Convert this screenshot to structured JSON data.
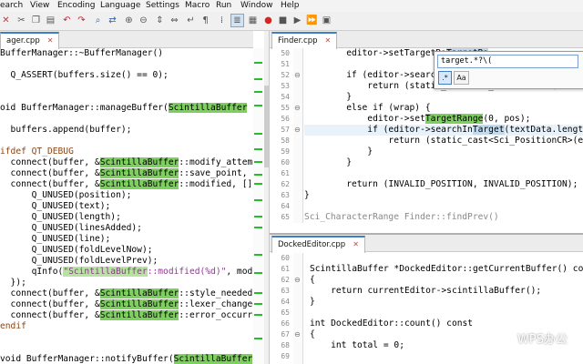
{
  "menu": [
    "earch",
    "View",
    "Encoding",
    "Language",
    "Settings",
    "Macro",
    "Run",
    "Window",
    "Help"
  ],
  "toolbar_icons": [
    "delete-icon",
    "cut-icon",
    "copy-icon",
    "paste-icon",
    "undo-icon",
    "redo-icon",
    "find-icon",
    "replace-icon",
    "zoom-in-icon",
    "zoom-out-icon",
    "sync-v-icon",
    "sync-h-icon",
    "wrap-icon",
    "all-chars-icon",
    "indent-guide-icon",
    "doc-map-icon",
    "function-list-icon",
    "record-macro-icon",
    "stop-macro-icon",
    "play-macro-icon",
    "run-macro-multiple-icon",
    "save-macro-icon"
  ],
  "left_pane": {
    "tab_label": "ager.cpp",
    "lines": [
      "BufferManager::~BufferManager()",
      "",
      "  Q_ASSERT(buffers.size() == 0);",
      "",
      "",
      "oid BufferManager::manageBuffer(",
      "",
      "  buffers.append(buffer);",
      "",
      "ifdef QT_DEBUG",
      "  connect(buffer, &",
      "  connect(buffer, &",
      "  connect(buffer, &",
      "      Q_UNUSED(position);",
      "      Q_UNUSED(text);",
      "      Q_UNUSED(length);",
      "      Q_UNUSED(linesAdded);",
      "      Q_UNUSED(line);",
      "      Q_UNUSED(foldLevelNow);",
      "      Q_UNUSED(foldLevelPrev);",
      "      qInfo(",
      "  });",
      "  connect(buffer, &",
      "  connect(buffer, &",
      "  connect(buffer, &",
      "endif",
      "",
      "",
      "void BufferManager::notifyBuffer("
    ],
    "hl_words": {
      "w5": "ScintillaBuffer",
      "w5b": " *",
      "w10": "ScintillaBuffer",
      "w10b": "::modify_attemp",
      "w11": "ScintillaBuffer",
      "w11b": "::save_point,",
      "w12": "ScintillaBuffer",
      "w12b": "::modified, []",
      "w20": "\"ScintillaBuffer",
      "w20b": "::modified(%d)\"",
      "w20c": ", modi",
      "w22": "ScintillaBuffer",
      "w22b": "::style_needed",
      "w23": "ScintillaBuffer",
      "w23b": "::lexer_changed",
      "w24": "ScintillaBuffer",
      "w24b": "::error_occurre",
      "w28": "ScintillaBuffer"
    }
  },
  "finder_pane": {
    "tab_label": "Finder.cpp",
    "line_numbers": [
      "50",
      "51",
      "52",
      "53",
      "54",
      "55",
      "56",
      "57",
      "58",
      "59",
      "60",
      "61",
      "62",
      "63",
      "64",
      "65"
    ],
    "lines": [
      "        editor->setTargetRa",
      "",
      "        if (editor->searchIn",
      "            return (static_cast<Sci_PositionCR>(editor->",
      "        }",
      "        else if (wrap) {",
      "            editor->set",
      "            if (editor->searchIn",
      "                return (static_cast<Sci_PositionCR>(edito",
      "            }",
      "        }",
      "",
      "        return (INVALID_POSITION, INVALID_POSITION);",
      "}",
      "",
      "Sci_CharacterRange Finder::findPrev()"
    ],
    "hl_target_range": "TargetRange",
    "hl_target_range_tail": "(0, pos);",
    "hl_target": "Target",
    "hl_target_tail": "(textData.length()",
    "hl_target_ra": "TargetRa"
  },
  "find_popup": {
    "value": "target.*?\\(",
    "regex_label": ".*",
    "case_label": "Aa"
  },
  "docked_pane": {
    "tab_label": "DockedEditor.cpp",
    "line_numbers": [
      "60",
      "61",
      "62",
      "63",
      "64",
      "65",
      "66",
      "67",
      "68",
      "69"
    ],
    "lines": [
      "",
      "ScintillaBuffer *DockedEditor::getCurrentBuffer() co",
      "{",
      "    return currentEditor->scintillaBuffer();",
      "}",
      "",
      "int DockedEditor::count() const",
      "{",
      "    int total = 0;",
      ""
    ]
  },
  "watermark": "WPS办公",
  "colors": {
    "match_green": "#7ed05e",
    "match_blue": "#bfdcf3",
    "change_marker": "#23c023",
    "tab_accent": "#3c7fc8"
  }
}
